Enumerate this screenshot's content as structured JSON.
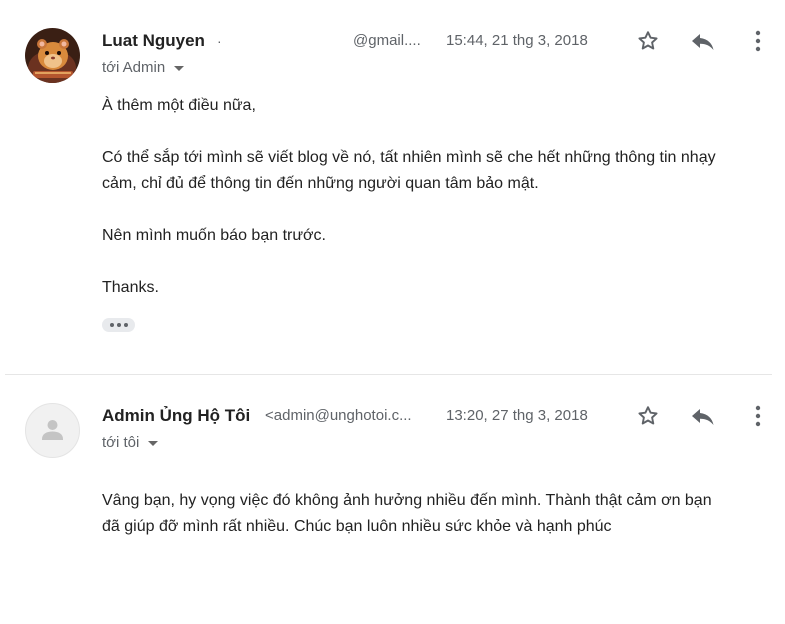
{
  "messages": [
    {
      "sender_name": "Luat Nguyen",
      "separator": "·",
      "sender_email": "@gmail....",
      "date": "15:44, 21 thg 3, 2018",
      "recipient": "tới Admin",
      "body": [
        "À thêm một điều nữa,",
        "Có thể sắp tới mình sẽ viết blog về nó, tất nhiên mình sẽ che hết những thông tin nhạy cảm, chỉ đủ để thông tin đến những người quan tâm bảo mật.",
        "Nên mình muốn báo bạn trước.",
        "Thanks."
      ],
      "avatar_icon": "hamster-photo",
      "actions": [
        "star-icon",
        "reply-icon",
        "more-vert-icon"
      ],
      "trimmed_content_icon": "more-horiz-icon"
    },
    {
      "sender_name": "Admin Ủng Hộ Tôi",
      "sender_email": "<admin@unghotoi.c...",
      "date": "13:20, 27 thg 3, 2018",
      "recipient": "tới tôi",
      "body": [
        "Vâng bạn, hy vọng việc đó không ảnh hưởng nhiều đến mình. Thành thật cảm ơn bạn đã giúp đỡ mình rất nhiều. Chúc bạn luôn nhiều sức khỏe và hạnh phúc"
      ],
      "avatar_icon": "default-person-icon",
      "actions": [
        "star-icon",
        "reply-icon",
        "more-vert-icon"
      ]
    }
  ],
  "colors": {
    "text_primary": "#222222",
    "text_secondary": "#5f6368",
    "icon_gray": "#5f6368",
    "divider": "#e6e6e6",
    "chip_bg": "#e8eaed"
  }
}
